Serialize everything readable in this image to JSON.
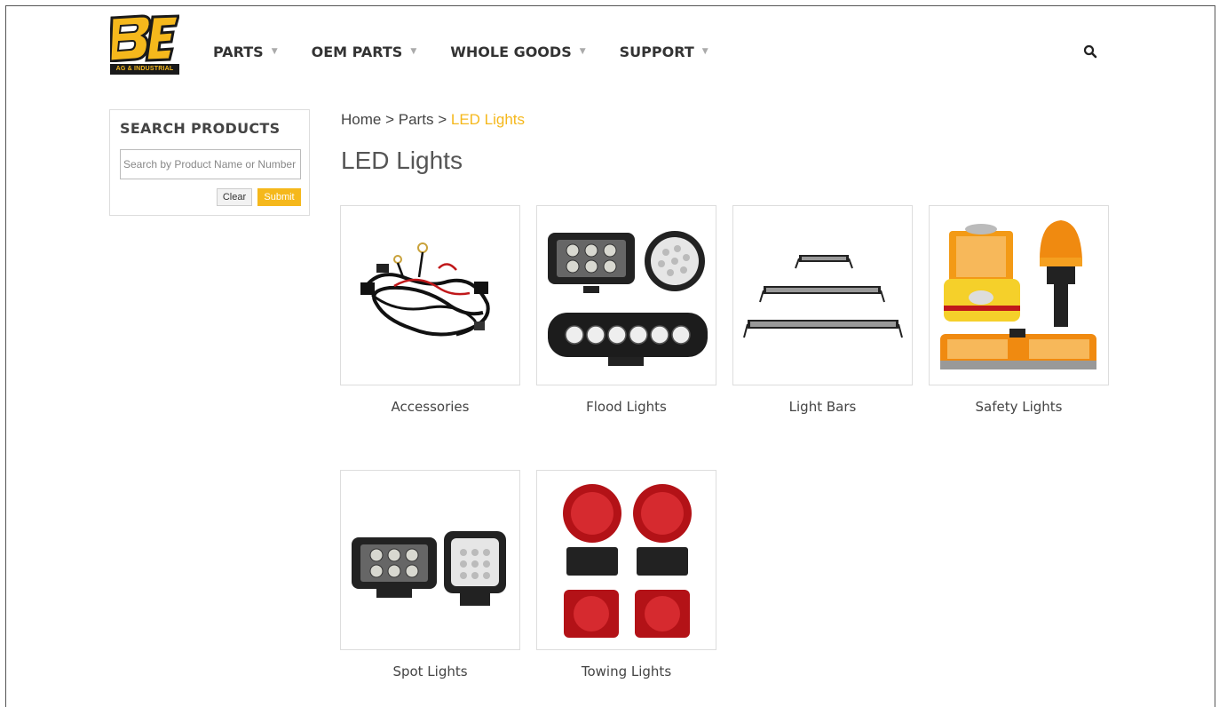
{
  "brand": {
    "logo_text": "BE",
    "logo_subtext": "AG & INDUSTRIAL",
    "accent": "#f5b81c",
    "dark": "#1a1a1a"
  },
  "nav": {
    "items": [
      {
        "label": "PARTS"
      },
      {
        "label": "OEM PARTS"
      },
      {
        "label": "WHOLE GOODS"
      },
      {
        "label": "SUPPORT"
      }
    ],
    "caret_icon": "chevron-down-icon",
    "search_icon": "search-icon"
  },
  "sidebar": {
    "title": "SEARCH PRODUCTS",
    "search_placeholder": "Search by Product Name or Number",
    "search_value": "",
    "clear_label": "Clear",
    "submit_label": "Submit"
  },
  "breadcrumb": {
    "items": [
      "Home",
      "Parts",
      "LED Lights"
    ],
    "separator": ">"
  },
  "page": {
    "title": "LED Lights"
  },
  "categories": [
    {
      "label": "Accessories",
      "image": "wiring-harness-image"
    },
    {
      "label": "Flood Lights",
      "image": "flood-lights-image"
    },
    {
      "label": "Light Bars",
      "image": "light-bars-image"
    },
    {
      "label": "Safety Lights",
      "image": "safety-lights-image"
    },
    {
      "label": "Spot Lights",
      "image": "spot-lights-image"
    },
    {
      "label": "Towing Lights",
      "image": "towing-lights-image"
    }
  ]
}
